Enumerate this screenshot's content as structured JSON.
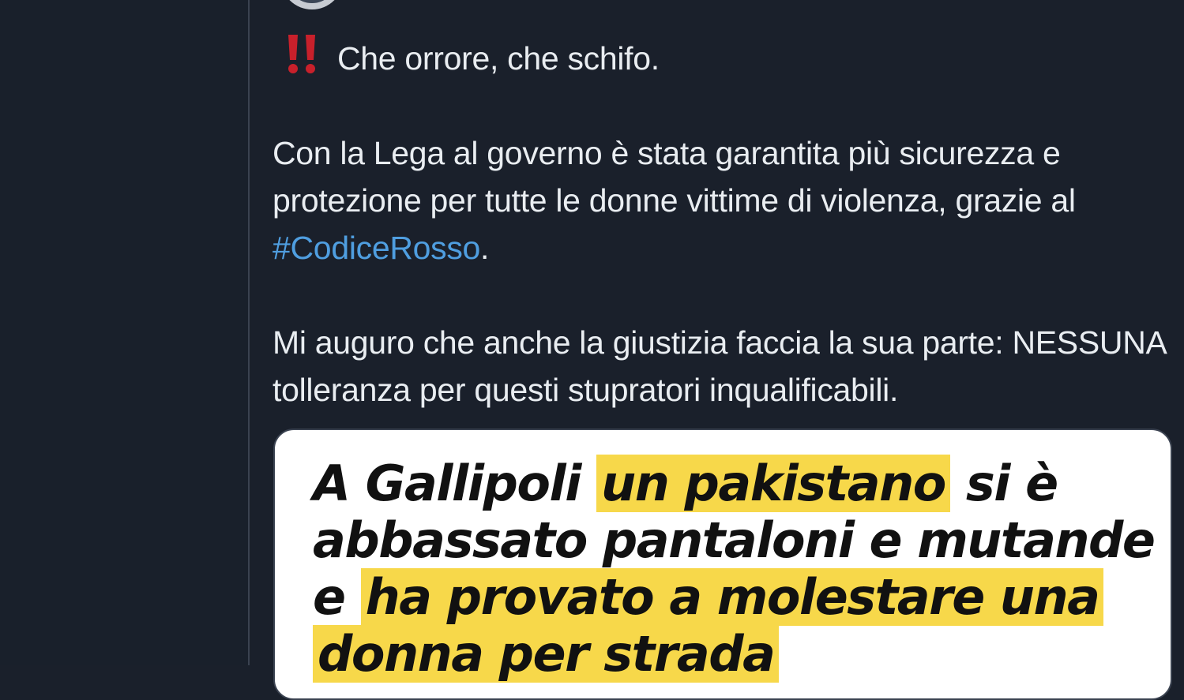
{
  "tweet": {
    "line1": "Che orrore, che schifo.",
    "para2_before": "Con la Lega al governo è stata garantita più sicurezza e protezione per tutte le donne vittime di violenza, grazie al ",
    "hashtag": "#CodiceRosso",
    "para2_after": ".",
    "para3": "Mi auguro che anche la giustizia faccia la sua parte: NESSUNA tolleranza per questi stupratori inqualificabili."
  },
  "media": {
    "l1_a": "A Gallipoli ",
    "l1_hl": "un pakistano",
    "l1_b": " si è",
    "l2": "abbassato pantaloni e mutande",
    "l3_a": "e ",
    "l3_hl": "ha provato a molestare una",
    "l4_hl": "donna per strada"
  },
  "colors": {
    "background": "#1a202b",
    "text": "#e9edf1",
    "hashtag": "#4f9ee0",
    "highlight": "#f7d84a",
    "alert": "#c8202b"
  },
  "icons": {
    "alert": "double-exclamation-icon"
  }
}
